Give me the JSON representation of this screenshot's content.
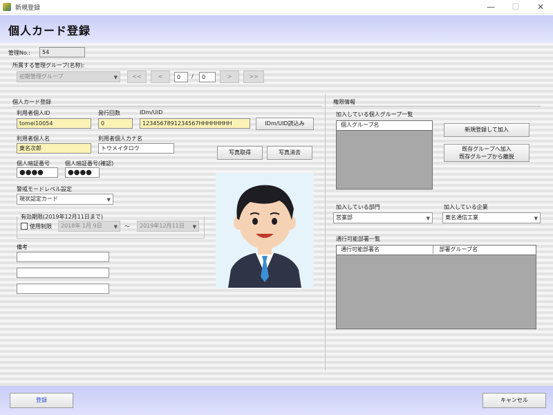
{
  "window": {
    "title": "新規登録",
    "minimize_icon": "minimize-icon",
    "maximize_icon": "maximize-icon",
    "close_icon": "close-icon",
    "minimize": "—",
    "maximize": "☐",
    "close": "✕"
  },
  "header": {
    "title": "個人カード登録"
  },
  "top": {
    "mgmt_no_label": "管理No.:",
    "mgmt_no_value": "54",
    "group_label": "所属する管理グループ(名称):",
    "group_value": "初期管理グループ",
    "nav": {
      "first": "<<",
      "prev": "<",
      "page": "0",
      "sep": "/",
      "total": "0",
      "next": ">",
      "last": ">>"
    }
  },
  "card": {
    "section_label": "個人カード登録",
    "user_id_label": "利用者個人ID",
    "user_id_value": "tomei10054",
    "issue_count_label": "発行回数",
    "issue_count_value": "0",
    "idm_label": "IDm/UID",
    "idm_value": "1234567891234567HHHHHHHH",
    "idm_read_button": "IDm/UID読込み",
    "name_label": "利用者個人名",
    "name_value": "東名次郎",
    "kana_label": "利用者個人カナ名",
    "kana_value": "トウメイタロウ",
    "photo_get_button": "写真取得",
    "photo_delete_button": "写真消去",
    "pin_label": "個人暗証番号",
    "pin_value": "●●●●",
    "pin_confirm_label": "個人暗証番号(確認)",
    "pin_confirm_value": "●●●●",
    "security_label": "警戒モードレベル設定",
    "security_value": "現状認定カード",
    "validity_label": "有効期限(2019年12月11日まで)",
    "use_limit_label": "使用制限",
    "date_from": "2018年 1月 9日",
    "date_tilde": "〜",
    "date_to": "2019年12月11日",
    "remarks_label": "備考",
    "remarks": [
      "",
      "",
      ""
    ]
  },
  "auth": {
    "section_label": "権限情報",
    "personal_group_label": "加入している個人グループ一覧",
    "personal_group_column": "個人グループ名",
    "new_join_button": "新規登録して加入",
    "existing_join_button_line1": "既存グループへ加入",
    "existing_join_button_line2": "既存グループから離脱",
    "department_label": "加入している部門",
    "department_value": "営業部",
    "company_label": "加入している企業",
    "company_value": "東名通信工業",
    "passable_label": "通行可能部署一覧",
    "passable_columns": [
      "通行可能部署名",
      "部署グループ名"
    ]
  },
  "footer": {
    "register_button": "登録",
    "cancel_button": "キャンセル"
  }
}
